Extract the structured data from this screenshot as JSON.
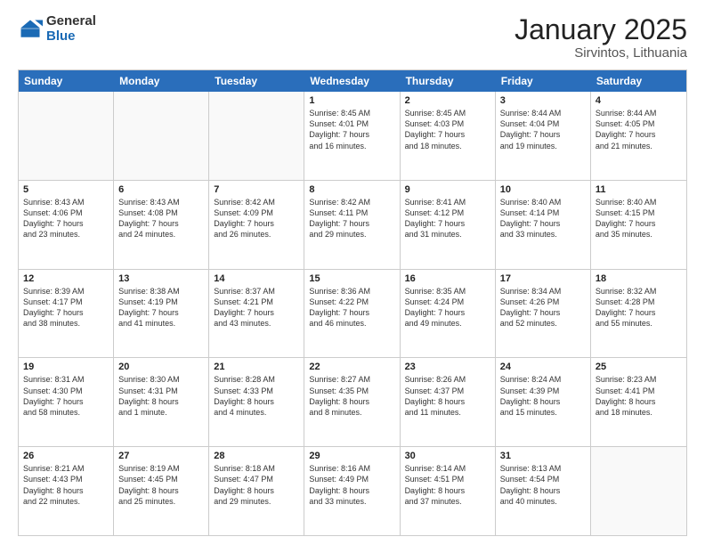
{
  "logo": {
    "general": "General",
    "blue": "Blue"
  },
  "title": "January 2025",
  "subtitle": "Sirvintos, Lithuania",
  "days": [
    "Sunday",
    "Monday",
    "Tuesday",
    "Wednesday",
    "Thursday",
    "Friday",
    "Saturday"
  ],
  "weeks": [
    [
      {
        "day": "",
        "text": "",
        "empty": true
      },
      {
        "day": "",
        "text": "",
        "empty": true
      },
      {
        "day": "",
        "text": "",
        "empty": true
      },
      {
        "day": "1",
        "text": "Sunrise: 8:45 AM\nSunset: 4:01 PM\nDaylight: 7 hours\nand 16 minutes."
      },
      {
        "day": "2",
        "text": "Sunrise: 8:45 AM\nSunset: 4:03 PM\nDaylight: 7 hours\nand 18 minutes."
      },
      {
        "day": "3",
        "text": "Sunrise: 8:44 AM\nSunset: 4:04 PM\nDaylight: 7 hours\nand 19 minutes."
      },
      {
        "day": "4",
        "text": "Sunrise: 8:44 AM\nSunset: 4:05 PM\nDaylight: 7 hours\nand 21 minutes."
      }
    ],
    [
      {
        "day": "5",
        "text": "Sunrise: 8:43 AM\nSunset: 4:06 PM\nDaylight: 7 hours\nand 23 minutes."
      },
      {
        "day": "6",
        "text": "Sunrise: 8:43 AM\nSunset: 4:08 PM\nDaylight: 7 hours\nand 24 minutes."
      },
      {
        "day": "7",
        "text": "Sunrise: 8:42 AM\nSunset: 4:09 PM\nDaylight: 7 hours\nand 26 minutes."
      },
      {
        "day": "8",
        "text": "Sunrise: 8:42 AM\nSunset: 4:11 PM\nDaylight: 7 hours\nand 29 minutes."
      },
      {
        "day": "9",
        "text": "Sunrise: 8:41 AM\nSunset: 4:12 PM\nDaylight: 7 hours\nand 31 minutes."
      },
      {
        "day": "10",
        "text": "Sunrise: 8:40 AM\nSunset: 4:14 PM\nDaylight: 7 hours\nand 33 minutes."
      },
      {
        "day": "11",
        "text": "Sunrise: 8:40 AM\nSunset: 4:15 PM\nDaylight: 7 hours\nand 35 minutes."
      }
    ],
    [
      {
        "day": "12",
        "text": "Sunrise: 8:39 AM\nSunset: 4:17 PM\nDaylight: 7 hours\nand 38 minutes."
      },
      {
        "day": "13",
        "text": "Sunrise: 8:38 AM\nSunset: 4:19 PM\nDaylight: 7 hours\nand 41 minutes."
      },
      {
        "day": "14",
        "text": "Sunrise: 8:37 AM\nSunset: 4:21 PM\nDaylight: 7 hours\nand 43 minutes."
      },
      {
        "day": "15",
        "text": "Sunrise: 8:36 AM\nSunset: 4:22 PM\nDaylight: 7 hours\nand 46 minutes."
      },
      {
        "day": "16",
        "text": "Sunrise: 8:35 AM\nSunset: 4:24 PM\nDaylight: 7 hours\nand 49 minutes."
      },
      {
        "day": "17",
        "text": "Sunrise: 8:34 AM\nSunset: 4:26 PM\nDaylight: 7 hours\nand 52 minutes."
      },
      {
        "day": "18",
        "text": "Sunrise: 8:32 AM\nSunset: 4:28 PM\nDaylight: 7 hours\nand 55 minutes."
      }
    ],
    [
      {
        "day": "19",
        "text": "Sunrise: 8:31 AM\nSunset: 4:30 PM\nDaylight: 7 hours\nand 58 minutes."
      },
      {
        "day": "20",
        "text": "Sunrise: 8:30 AM\nSunset: 4:31 PM\nDaylight: 8 hours\nand 1 minute."
      },
      {
        "day": "21",
        "text": "Sunrise: 8:28 AM\nSunset: 4:33 PM\nDaylight: 8 hours\nand 4 minutes."
      },
      {
        "day": "22",
        "text": "Sunrise: 8:27 AM\nSunset: 4:35 PM\nDaylight: 8 hours\nand 8 minutes."
      },
      {
        "day": "23",
        "text": "Sunrise: 8:26 AM\nSunset: 4:37 PM\nDaylight: 8 hours\nand 11 minutes."
      },
      {
        "day": "24",
        "text": "Sunrise: 8:24 AM\nSunset: 4:39 PM\nDaylight: 8 hours\nand 15 minutes."
      },
      {
        "day": "25",
        "text": "Sunrise: 8:23 AM\nSunset: 4:41 PM\nDaylight: 8 hours\nand 18 minutes."
      }
    ],
    [
      {
        "day": "26",
        "text": "Sunrise: 8:21 AM\nSunset: 4:43 PM\nDaylight: 8 hours\nand 22 minutes."
      },
      {
        "day": "27",
        "text": "Sunrise: 8:19 AM\nSunset: 4:45 PM\nDaylight: 8 hours\nand 25 minutes."
      },
      {
        "day": "28",
        "text": "Sunrise: 8:18 AM\nSunset: 4:47 PM\nDaylight: 8 hours\nand 29 minutes."
      },
      {
        "day": "29",
        "text": "Sunrise: 8:16 AM\nSunset: 4:49 PM\nDaylight: 8 hours\nand 33 minutes."
      },
      {
        "day": "30",
        "text": "Sunrise: 8:14 AM\nSunset: 4:51 PM\nDaylight: 8 hours\nand 37 minutes."
      },
      {
        "day": "31",
        "text": "Sunrise: 8:13 AM\nSunset: 4:54 PM\nDaylight: 8 hours\nand 40 minutes."
      },
      {
        "day": "",
        "text": "",
        "empty": true
      }
    ]
  ]
}
